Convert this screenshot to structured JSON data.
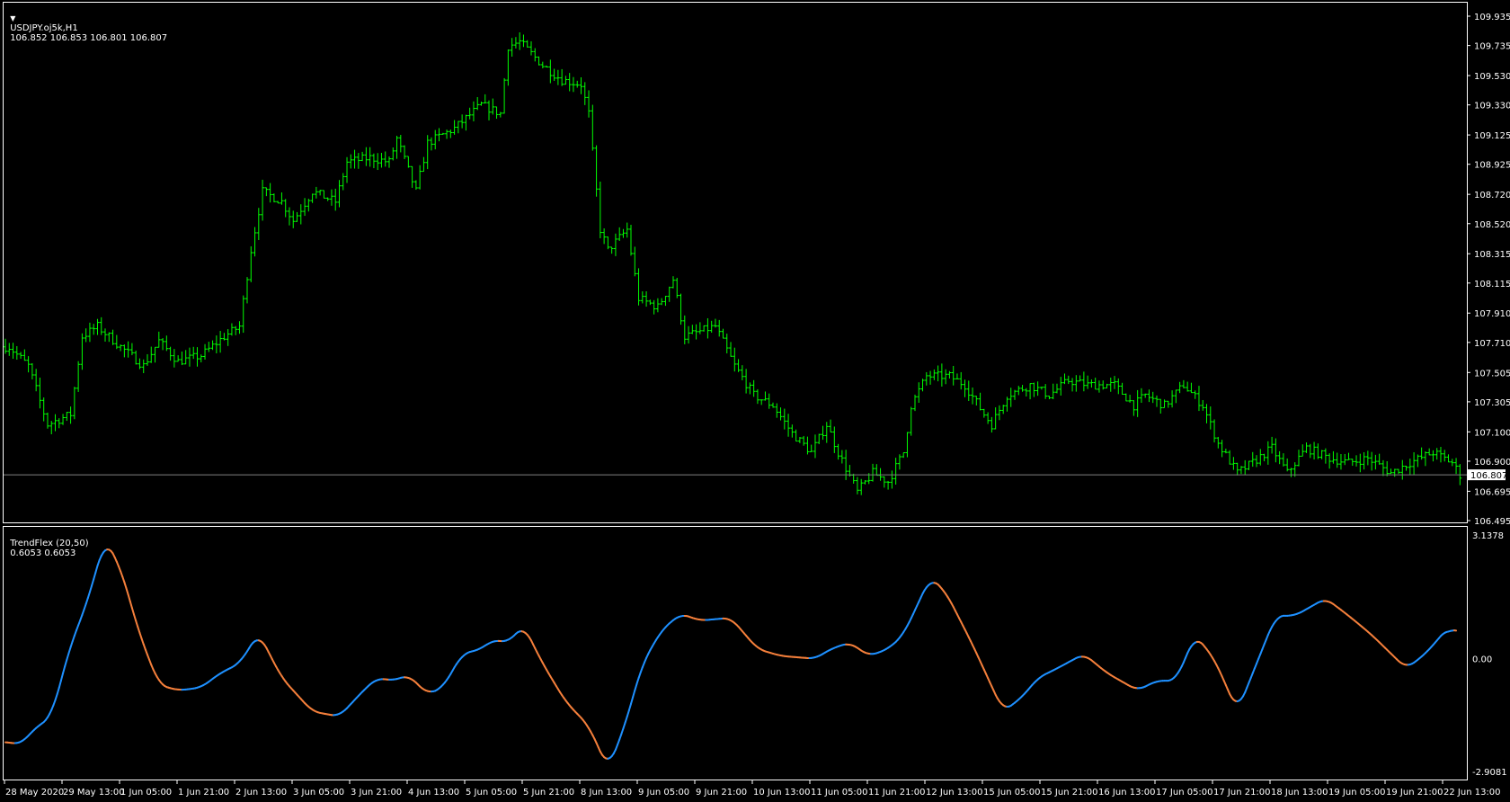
{
  "header": {
    "symbol": "USDJPY.oj5k,H1",
    "ohlc": "106.852 106.853 106.801 106.807"
  },
  "indicator_header": {
    "name": "TrendFlex (20,50)",
    "values": "0.6053 0.6053"
  },
  "colors": {
    "bars": "#00ff00",
    "up": "#1e90ff",
    "down": "#f47f3b",
    "grid": "#ffffff",
    "price_line": "#808080"
  },
  "chart_data": [
    {
      "type": "ohlc",
      "title": "USDJPY.oj5k,H1",
      "ylim": [
        106.495,
        109.935
      ],
      "y_ticks": [
        "109.935",
        "109.735",
        "109.530",
        "109.330",
        "109.125",
        "108.925",
        "108.720",
        "108.520",
        "108.315",
        "108.115",
        "107.910",
        "107.710",
        "107.505",
        "107.305",
        "107.100",
        "106.900",
        "106.695",
        "106.495"
      ],
      "current_price": "106.807",
      "x_ticks": [
        "28 May 2020",
        "29 May 13:00",
        "1 Jun 05:00",
        "1 Jun 21:00",
        "2 Jun 13:00",
        "3 Jun 05:00",
        "3 Jun 21:00",
        "4 Jun 13:00",
        "5 Jun 05:00",
        "5 Jun 21:00",
        "8 Jun 13:00",
        "9 Jun 05:00",
        "9 Jun 21:00",
        "10 Jun 13:00",
        "11 Jun 05:00",
        "11 Jun 21:00",
        "12 Jun 13:00",
        "15 Jun 05:00",
        "15 Jun 21:00",
        "16 Jun 13:00",
        "17 Jun 05:00",
        "17 Jun 21:00",
        "18 Jun 13:00",
        "19 Jun 05:00",
        "19 Jun 21:00",
        "22 Jun 13:00"
      ],
      "close_keyframes": [
        [
          1,
          107.68
        ],
        [
          6,
          107.55
        ],
        [
          11,
          107.15
        ],
        [
          17,
          107.22
        ],
        [
          20,
          107.75
        ],
        [
          24,
          107.82
        ],
        [
          30,
          107.68
        ],
        [
          36,
          107.55
        ],
        [
          40,
          107.72
        ],
        [
          45,
          107.58
        ],
        [
          51,
          107.62
        ],
        [
          57,
          107.75
        ],
        [
          61,
          107.82
        ],
        [
          64,
          108.34
        ],
        [
          67,
          108.74
        ],
        [
          72,
          108.67
        ],
        [
          75,
          108.54
        ],
        [
          80,
          108.74
        ],
        [
          86,
          108.67
        ],
        [
          89,
          108.94
        ],
        [
          95,
          108.97
        ],
        [
          100,
          108.94
        ],
        [
          102,
          109.1
        ],
        [
          107,
          108.74
        ],
        [
          110,
          109.07
        ],
        [
          117,
          109.17
        ],
        [
          124,
          109.33
        ],
        [
          129,
          109.27
        ],
        [
          131,
          109.73
        ],
        [
          134,
          109.76
        ],
        [
          140,
          109.6
        ],
        [
          145,
          109.5
        ],
        [
          150,
          109.47
        ],
        [
          152,
          109.27
        ],
        [
          155,
          108.48
        ],
        [
          157,
          108.34
        ],
        [
          162,
          108.48
        ],
        [
          165,
          108.01
        ],
        [
          170,
          107.95
        ],
        [
          174,
          108.14
        ],
        [
          177,
          107.75
        ],
        [
          185,
          107.82
        ],
        [
          190,
          107.55
        ],
        [
          195,
          107.35
        ],
        [
          200,
          107.28
        ],
        [
          205,
          107.09
        ],
        [
          210,
          106.96
        ],
        [
          214,
          107.15
        ],
        [
          217,
          106.96
        ],
        [
          222,
          106.69
        ],
        [
          226,
          106.82
        ],
        [
          230,
          106.76
        ],
        [
          234,
          106.96
        ],
        [
          236,
          107.28
        ],
        [
          240,
          107.48
        ],
        [
          246,
          107.48
        ],
        [
          250,
          107.42
        ],
        [
          255,
          107.22
        ],
        [
          257,
          107.15
        ],
        [
          261,
          107.35
        ],
        [
          267,
          107.42
        ],
        [
          272,
          107.35
        ],
        [
          277,
          107.45
        ],
        [
          282,
          107.42
        ],
        [
          289,
          107.42
        ],
        [
          294,
          107.28
        ],
        [
          297,
          107.35
        ],
        [
          302,
          107.28
        ],
        [
          307,
          107.42
        ],
        [
          312,
          107.28
        ],
        [
          316,
          107.02
        ],
        [
          321,
          106.82
        ],
        [
          325,
          106.89
        ],
        [
          330,
          106.99
        ],
        [
          334,
          106.82
        ],
        [
          339,
          106.99
        ],
        [
          345,
          106.92
        ],
        [
          350,
          106.89
        ],
        [
          355,
          106.92
        ],
        [
          361,
          106.82
        ],
        [
          366,
          106.89
        ],
        [
          372,
          106.96
        ],
        [
          377,
          106.89
        ],
        [
          379,
          106.807
        ]
      ]
    },
    {
      "type": "line",
      "title": "TrendFlex (20,50)",
      "ylim": [
        -2.9081,
        3.1378
      ],
      "y_ticks": [
        "3.1378",
        "0.00",
        "-2.9081"
      ],
      "keyframes": [
        [
          1,
          -2.05
        ],
        [
          4,
          -2.12
        ],
        [
          7,
          -1.77
        ],
        [
          12,
          -1.42
        ],
        [
          17,
          0.35
        ],
        [
          21,
          1.3
        ],
        [
          26,
          2.95
        ],
        [
          30,
          2.24
        ],
        [
          35,
          0.59
        ],
        [
          40,
          -0.64
        ],
        [
          45,
          -0.78
        ],
        [
          51,
          -0.71
        ],
        [
          56,
          -0.35
        ],
        [
          61,
          -0.12
        ],
        [
          66,
          0.64
        ],
        [
          72,
          -0.47
        ],
        [
          80,
          -1.3
        ],
        [
          87,
          -1.42
        ],
        [
          94,
          -0.71
        ],
        [
          97,
          -0.47
        ],
        [
          101,
          -0.54
        ],
        [
          105,
          -0.4
        ],
        [
          110,
          -0.87
        ],
        [
          114,
          -0.71
        ],
        [
          119,
          0.12
        ],
        [
          124,
          0.24
        ],
        [
          127,
          0.47
        ],
        [
          131,
          0.4
        ],
        [
          135,
          0.83
        ],
        [
          140,
          -0.12
        ],
        [
          146,
          -1.06
        ],
        [
          152,
          -1.65
        ],
        [
          157,
          -2.71
        ],
        [
          161,
          -1.77
        ],
        [
          166,
          -0.12
        ],
        [
          171,
          0.71
        ],
        [
          176,
          1.11
        ],
        [
          181,
          0.94
        ],
        [
          189,
          1.01
        ],
        [
          196,
          0.24
        ],
        [
          202,
          0.07
        ],
        [
          211,
          0
        ],
        [
          215,
          0.24
        ],
        [
          220,
          0.4
        ],
        [
          225,
          0.07
        ],
        [
          230,
          0.24
        ],
        [
          234,
          0.59
        ],
        [
          241,
          2.01
        ],
        [
          245,
          1.65
        ],
        [
          252,
          0.35
        ],
        [
          260,
          -1.3
        ],
        [
          265,
          -0.94
        ],
        [
          269,
          -0.47
        ],
        [
          274,
          -0.24
        ],
        [
          281,
          0.12
        ],
        [
          287,
          -0.35
        ],
        [
          295,
          -0.78
        ],
        [
          300,
          -0.54
        ],
        [
          305,
          -0.54
        ],
        [
          310,
          0.59
        ],
        [
          315,
          0
        ],
        [
          321,
          -1.3
        ],
        [
          326,
          -0.12
        ],
        [
          331,
          1.06
        ],
        [
          336,
          1.06
        ],
        [
          344,
          1.49
        ],
        [
          350,
          1.06
        ],
        [
          356,
          0.59
        ],
        [
          365,
          -0.24
        ],
        [
          370,
          0.12
        ],
        [
          376,
          0.78
        ],
        [
          378,
          0.6053
        ]
      ]
    }
  ]
}
